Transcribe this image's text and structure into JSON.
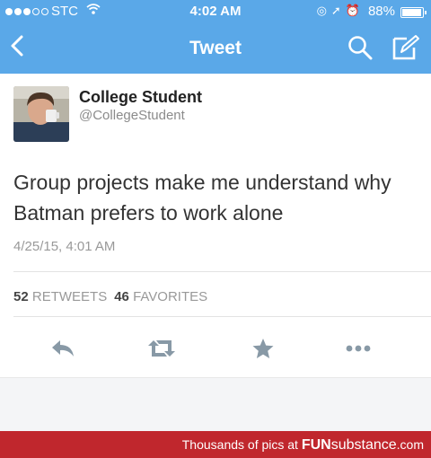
{
  "status_bar": {
    "carrier": "STC",
    "time": "4:02 AM",
    "battery": "88%"
  },
  "nav": {
    "title": "Tweet",
    "back_icon": "chevron-left-icon",
    "search_icon": "search-icon",
    "compose_icon": "compose-icon"
  },
  "tweet": {
    "name": "College Student",
    "handle": "@CollegeStudent",
    "text": "Group projects make me understand why Batman prefers to work alone",
    "timestamp": "4/25/15, 4:01 AM",
    "retweets_count": "52",
    "retweets_label": "RETWEETS",
    "favorites_count": "46",
    "favorites_label": "FAVORITES"
  },
  "actions": [
    "reply-icon",
    "retweet-icon",
    "favorite-icon",
    "more-icon"
  ],
  "banner": {
    "prefix": "Thousands of pics at",
    "brand_fun": "FUN",
    "brand_substance": "substance",
    "brand_tld": ".com"
  },
  "colors": {
    "nav_blue": "#5aa8e8",
    "banner_red": "#c0272d",
    "action_gray": "#8899a6"
  }
}
